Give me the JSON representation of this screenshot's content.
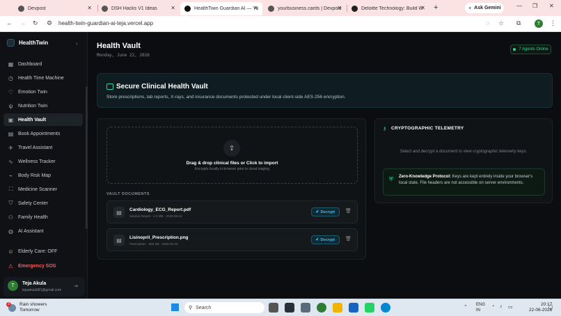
{
  "browser": {
    "tabs": [
      {
        "title": "Devpost",
        "active": false
      },
      {
        "title": "DSH Hacks V1 Ideas",
        "active": false
      },
      {
        "title": "HealthTwin Guardian AI — Yo",
        "active": true
      },
      {
        "title": "yourbusiness.cards | Devpost",
        "active": false
      },
      {
        "title": "Deloitte Technology: Build W",
        "active": false
      }
    ],
    "ask_gemini": "Ask Gemini",
    "url": "health-twin-guardian-ai-teja.vercel.app",
    "profile_initial": "T"
  },
  "sidebar": {
    "brand": "HealthTwin",
    "items": [
      {
        "label": "Dashboard",
        "icon": "dashboard-icon",
        "glyph": "▦"
      },
      {
        "label": "Health Time Machine",
        "icon": "clock-icon",
        "glyph": "◷"
      },
      {
        "label": "Emotion Twin",
        "icon": "heart-icon",
        "glyph": "♡"
      },
      {
        "label": "Nutrition Twin",
        "icon": "utensils-icon",
        "glyph": "ψ"
      },
      {
        "label": "Health Vault",
        "icon": "folder-lock-icon",
        "glyph": "▣"
      },
      {
        "label": "Book Appointments",
        "icon": "calendar-icon",
        "glyph": "▤"
      },
      {
        "label": "Travel Assistant",
        "icon": "plane-icon",
        "glyph": "✈"
      },
      {
        "label": "Wellness Tracker",
        "icon": "activity-icon",
        "glyph": "∿"
      },
      {
        "label": "Body Risk Map",
        "icon": "pulse-icon",
        "glyph": "⌁"
      },
      {
        "label": "Medicine Scanner",
        "icon": "scan-icon",
        "glyph": "⛶"
      },
      {
        "label": "Safety Center",
        "icon": "shield-icon",
        "glyph": "⛉"
      },
      {
        "label": "Family Health",
        "icon": "users-icon",
        "glyph": "⚇"
      },
      {
        "label": "AI Assistant",
        "icon": "globe-icon",
        "glyph": "◍"
      }
    ],
    "elderly_care": "Elderly Care: OFF",
    "emergency_sos": "Emergency SOS",
    "user": {
      "initial": "T",
      "name": "Teja Akula",
      "email": "tejaakula681@gmail.com"
    }
  },
  "header": {
    "title": "Health Vault",
    "date": "Monday, June 22, 2026",
    "agents_online": "7 Agents Online"
  },
  "hero": {
    "title": "Secure Clinical Health Vault",
    "description": "Store prescriptions, lab reports, X-rays, and insurance documents protected under local client-side AES-256 encryption."
  },
  "upload": {
    "title": "Drag & drop clinical files or Click to import",
    "subtitle": "Encrypts locally in browser prior to cloud staging"
  },
  "vault": {
    "label": "VAULT DOCUMENTS",
    "decrypt_label": "Decrypt",
    "documents": [
      {
        "name": "Cardiology_ECG_Report.pdf",
        "meta": "Medical Report · 2.4 MB · 2026-06-15"
      },
      {
        "name": "Lisinopril_Prescription.png",
        "meta": "Prescription · 850 KB · 2026-05-20"
      }
    ]
  },
  "telemetry": {
    "title": "CRYPTOGRAPHIC TELEMETRY",
    "hint": "Select and decrypt a document to view cryptographic telemetry keys.",
    "zk_label": "Zero-Knowledge Protocol:",
    "zk_text": "Keys are kept entirely inside your browser's local state. File headers are not accessible on server environments."
  },
  "taskbar": {
    "weather_badge": "3",
    "weather_line1": "Rain showers",
    "weather_line2": "Tomorrow",
    "search_placeholder": "Search",
    "lang1": "ENG",
    "lang2": "IN",
    "time": "20:17",
    "date": "22-06-2026"
  },
  "colors": {
    "accent_green": "#34d399",
    "accent_blue": "#38bdf8",
    "sos_red": "#ff5b5b"
  }
}
